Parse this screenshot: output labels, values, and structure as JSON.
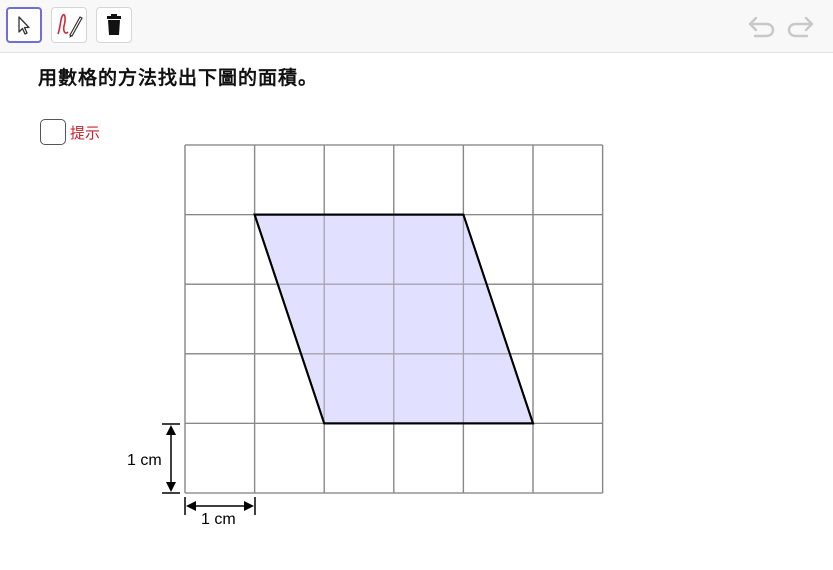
{
  "toolbar": {
    "tools": [
      {
        "name": "move-tool",
        "icon": "arrow-cursor-icon",
        "active": true
      },
      {
        "name": "pen-tool",
        "icon": "pen-icon",
        "active": false
      },
      {
        "name": "delete-tool",
        "icon": "trash-icon",
        "active": false
      }
    ],
    "undo_icon": "undo-icon",
    "redo_icon": "redo-icon",
    "accent": "#6e6ed6"
  },
  "prompt": "用數格的方法找出下圖的面積。",
  "hint": {
    "label": "提示",
    "checked": false,
    "color": "#c8202c"
  },
  "figure": {
    "grid_columns": 6,
    "grid_rows": 5,
    "grid_color": "#888888",
    "parallelogram": {
      "vertices_grid_units": [
        [
          1,
          4
        ],
        [
          4,
          4
        ],
        [
          5,
          1
        ],
        [
          2,
          1
        ]
      ],
      "fill": "#dcdcff",
      "stroke": "#000000"
    },
    "vertical_dimension_label": "1 cm",
    "horizontal_dimension_label": "1 cm"
  }
}
